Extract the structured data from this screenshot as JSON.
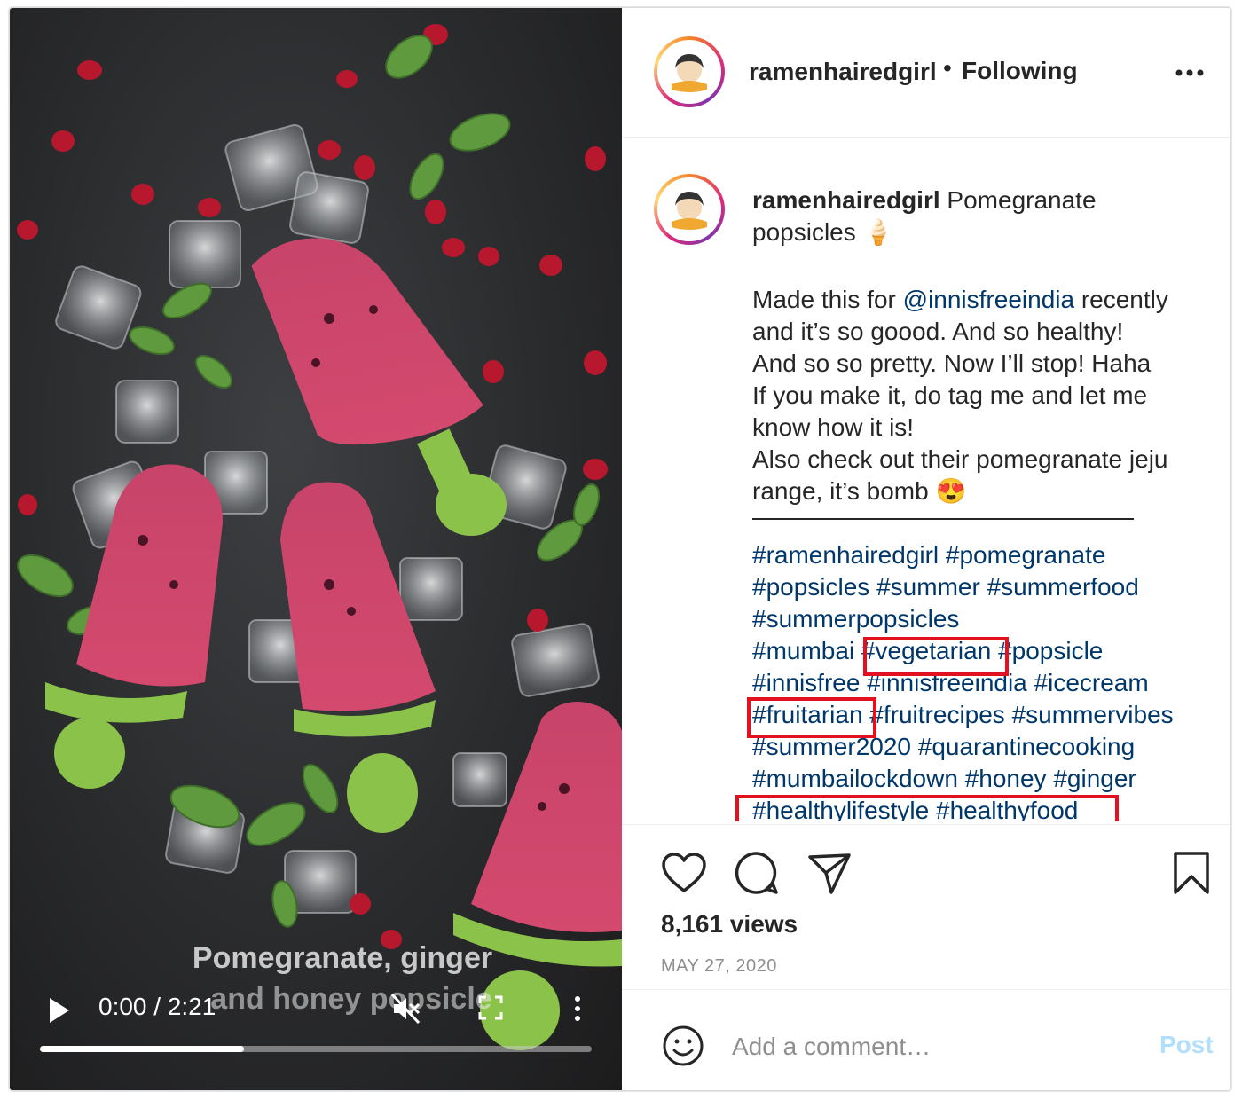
{
  "post": {
    "username": "ramenhairedgirl",
    "dot": "•",
    "following_label": "Following",
    "video": {
      "overlay_line1": "Pomegranate, ginger",
      "overlay_line2": "and honey popsicle",
      "time": "0:00 / 2:21",
      "progress_fraction": 0.37
    },
    "caption": {
      "username": "ramenhairedgirl",
      "title": "Pomegranate popsicles 🍦",
      "body": [
        {
          "pre": "Made this for ",
          "mention": "@innisfreeindia",
          "post": " recently"
        },
        {
          "pre": "and it’s so goood. And so healthy!"
        },
        {
          "pre": "And so so pretty. Now I’ll stop! Haha"
        },
        {
          "pre": "If you make it, do tag me and let me"
        },
        {
          "pre": "know how it is!"
        },
        {
          "pre": "Also check out their pomegranate jeju"
        },
        {
          "pre": "range, it’s bomb 😍"
        }
      ],
      "hashtags": {
        "line1": [
          "#ramenhairedgirl",
          "#pomegranate"
        ],
        "line2": [
          "#popsicles",
          "#summer",
          "#summerfood"
        ],
        "line3": [
          "#summerpopsicles"
        ],
        "line4": [
          "#mumbai",
          "#vegetarian",
          "#popsicle"
        ],
        "line5": [
          "#innisfree",
          "#innisfreeindia",
          "#icecream"
        ],
        "line6": [
          "#fruitarian",
          "#fruitrecipes",
          "#summervibes"
        ],
        "line7": [
          "#summer2020",
          "#quarantinecooking"
        ],
        "line8": [
          "#mumbailockdown",
          "#honey",
          "#ginger"
        ],
        "line9": [
          "#healthylifestyle",
          "#healthyfood"
        ]
      }
    },
    "views": "8,161 views",
    "date": "MAY 27, 2020",
    "comment": {
      "placeholder": "Add a comment…",
      "post_label": "Post"
    }
  },
  "colors": {
    "link": "#00376b",
    "highlight": "#e3101f",
    "post_button_disabled": "#b2dffc",
    "muted": "#8e8e8e"
  }
}
